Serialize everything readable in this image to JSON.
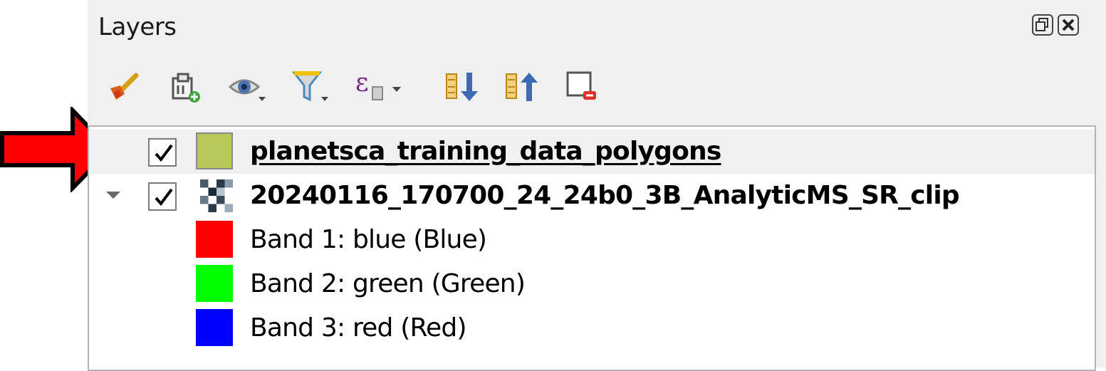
{
  "panel": {
    "title": "Layers"
  },
  "window_buttons": [
    {
      "name": "float-panel-button",
      "icon": "restore-icon"
    },
    {
      "name": "close-panel-button",
      "icon": "close-icon"
    }
  ],
  "toolbar": [
    {
      "name": "open-layer-styling-button",
      "icon": "paintbrush-icon"
    },
    {
      "name": "add-group-button",
      "icon": "add-group-icon"
    },
    {
      "name": "manage-map-themes-button",
      "icon": "eye-dropdown-icon"
    },
    {
      "name": "filter-legend-button",
      "icon": "filter-dropdown-icon"
    },
    {
      "name": "filter-by-expression-button",
      "icon": "epsilon-icon"
    },
    {
      "name": "expand-all-button",
      "icon": "expand-all-icon"
    },
    {
      "name": "collapse-all-button",
      "icon": "collapse-all-icon"
    },
    {
      "name": "remove-layer-button",
      "icon": "remove-layer-icon"
    }
  ],
  "layers": [
    {
      "name": "planetsca_training_data_polygons",
      "checked": true,
      "selected": true,
      "type": "vector-polygon",
      "symbol_color": "#b9c85a"
    },
    {
      "name": "20240116_170700_24_24b0_3B_AnalyticMS_SR_clip",
      "checked": true,
      "expanded": true,
      "type": "raster",
      "bands": [
        {
          "label": "Band 1: blue (Blue)",
          "color": "#ff0000"
        },
        {
          "label": "Band 2: green (Green)",
          "color": "#00ff00"
        },
        {
          "label": "Band 3: red (Red)",
          "color": "#0000ff"
        }
      ]
    }
  ],
  "annotation": {
    "pointer": "red-arrow",
    "color": "#ff0000"
  }
}
